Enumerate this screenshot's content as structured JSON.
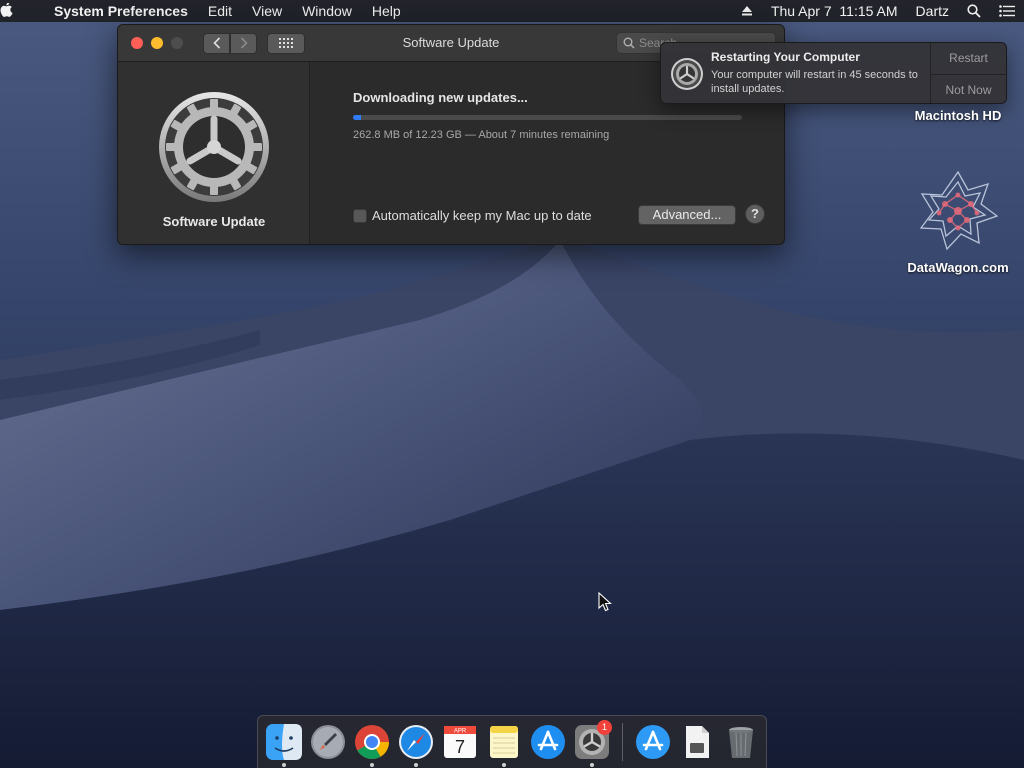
{
  "menubar": {
    "apple_icon": "apple-icon",
    "app_name": "System Preferences",
    "menus": [
      "Edit",
      "View",
      "Window",
      "Help"
    ],
    "clock": "Thu Apr 7  11:15 AM",
    "user": "Dartz"
  },
  "window": {
    "title": "Software Update",
    "search_placeholder": "Search",
    "side_label": "Software Update",
    "download_title": "Downloading new updates...",
    "download_progress_percent": 2,
    "download_status": "262.8 MB of 12.23 GB — About 7 minutes remaining",
    "auto_update_label": "Automatically keep my Mac up to date",
    "auto_update_checked": false,
    "advanced_button": "Advanced...",
    "help_button": "?"
  },
  "notification": {
    "title": "Restarting Your Computer",
    "body": "Your computer will restart in 45 seconds to install updates.",
    "restart_button": "Restart",
    "not_now_button": "Not Now"
  },
  "desktop": {
    "icons": [
      {
        "label": "Macintosh HD",
        "icon": "hard-drive-icon"
      },
      {
        "label": "DataWagon.com",
        "icon": "datawagon-logo-icon"
      }
    ]
  },
  "dock": {
    "apps": [
      {
        "name": "finder-icon",
        "running": true
      },
      {
        "name": "launchpad-icon",
        "running": false
      },
      {
        "name": "chrome-icon",
        "running": true
      },
      {
        "name": "safari-icon",
        "running": true
      },
      {
        "name": "calendar-icon",
        "running": false,
        "month": "APR",
        "day": "7"
      },
      {
        "name": "notes-icon",
        "running": true
      },
      {
        "name": "app-store-icon",
        "running": false
      },
      {
        "name": "system-preferences-icon",
        "running": true,
        "badge": "1"
      },
      {
        "name": "app-store-download-icon",
        "running": false
      },
      {
        "name": "file-icon",
        "running": false
      },
      {
        "name": "trash-icon",
        "running": false
      }
    ]
  },
  "colors": {
    "progress_fill": "#2f7cf6",
    "badge": "#f0413a",
    "close_button": "#ff5f57",
    "minimize_button": "#febc2e"
  }
}
